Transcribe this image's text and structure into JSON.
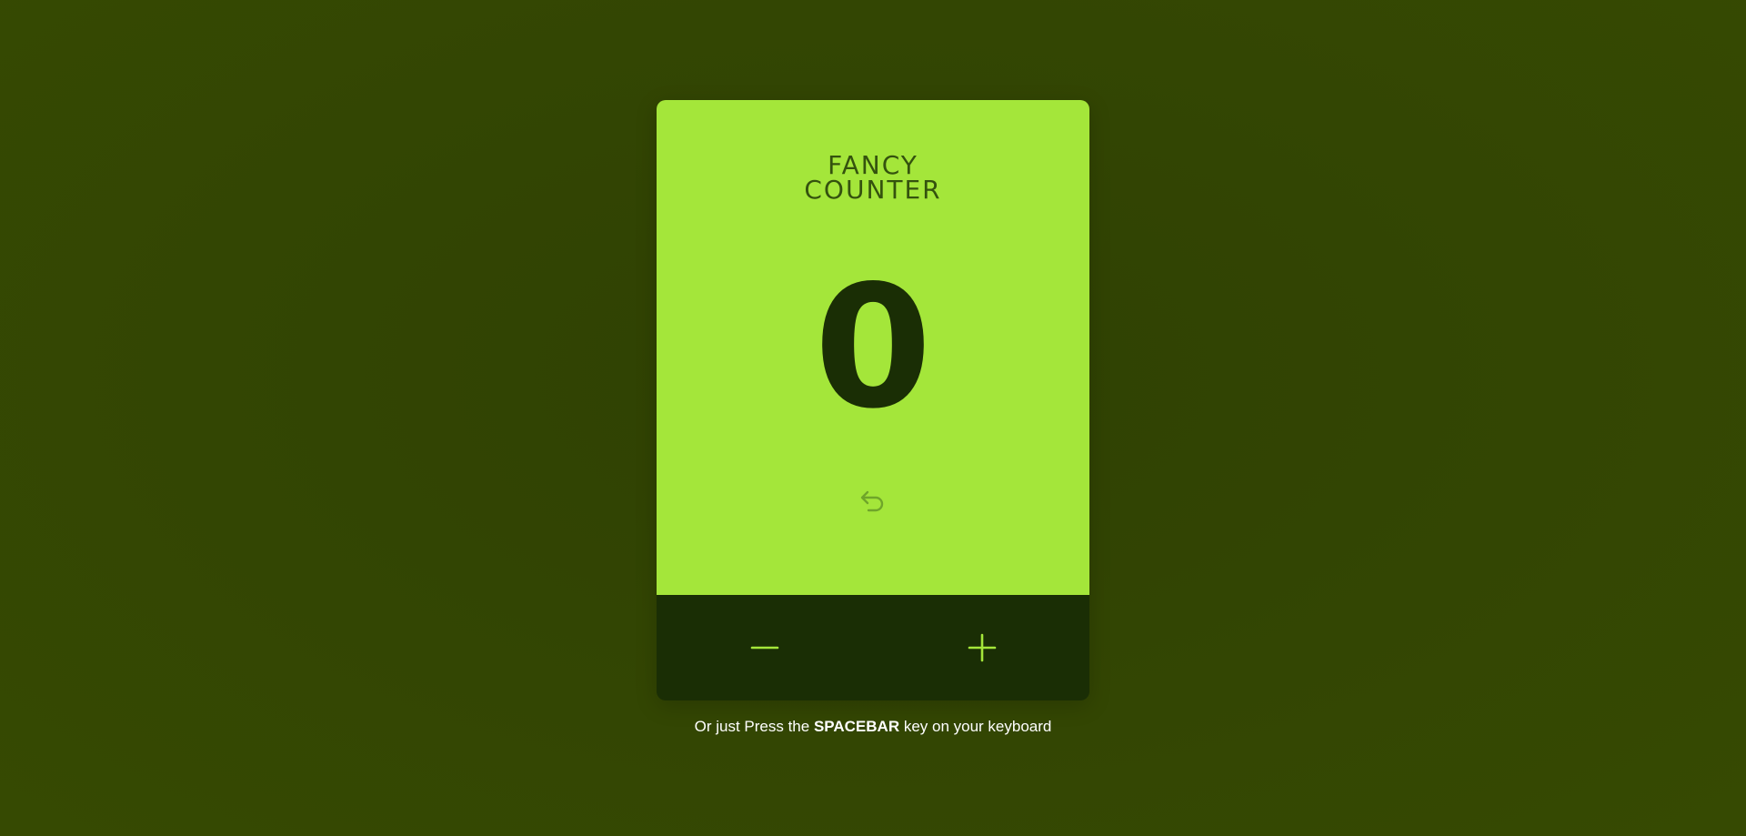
{
  "app": {
    "title_line_1": "FANCY",
    "title_line_2": "COUNTER"
  },
  "counter": {
    "value": "0"
  },
  "controls": {
    "reset_icon": "undo-arrow-icon",
    "decrease_icon": "minus-icon",
    "increase_icon": "plus-icon"
  },
  "hint": {
    "prefix": "Or just Press the ",
    "key": "SPACEBAR",
    "suffix": " key on your keyboard"
  },
  "colors": {
    "background": "#334603",
    "card_top": "#a4e63a",
    "card_bottom": "#1a2e05",
    "title": "#34520e",
    "count": "#1a2e05",
    "accent": "#a4e63a"
  }
}
